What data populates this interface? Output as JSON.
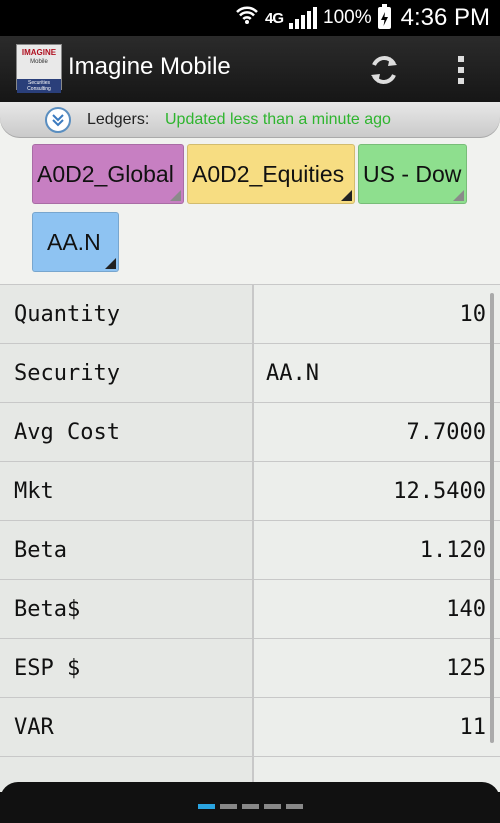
{
  "status_bar": {
    "network": "4G",
    "battery": "100%",
    "time": "4:36 PM"
  },
  "app": {
    "title": "Imagine Mobile",
    "logo_line1": "IMAGINE",
    "logo_line2": "Mobile",
    "logo_line3": "Securities   Consulting"
  },
  "ledger": {
    "label": "Ledgers:",
    "status": "Updated less than a minute ago"
  },
  "chips": [
    {
      "label": "A0D2_Global",
      "color": "#c77fc2"
    },
    {
      "label": "A0D2_Equities",
      "color": "#f7dd82"
    },
    {
      "label": "US - Dow",
      "color": "#8edf8e"
    },
    {
      "label": "AA.N",
      "color": "#8ec3f2"
    }
  ],
  "rows": [
    {
      "label": "Quantity",
      "value": "10"
    },
    {
      "label": "Security",
      "value": "AA.N"
    },
    {
      "label": "Avg Cost",
      "value": "7.7000"
    },
    {
      "label": "Mkt",
      "value": "12.5400"
    },
    {
      "label": "Beta",
      "value": "1.120"
    },
    {
      "label": "Beta$",
      "value": "140"
    },
    {
      "label": "ESP $",
      "value": "125"
    },
    {
      "label": "VAR",
      "value": "11"
    }
  ],
  "pager": {
    "pages": 5,
    "current": 1
  }
}
